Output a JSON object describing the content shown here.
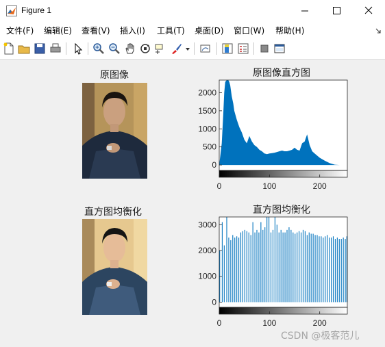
{
  "window": {
    "title": "Figure 1",
    "controls": [
      "minimize",
      "maximize",
      "close"
    ]
  },
  "menu": [
    {
      "label": "文件(F)"
    },
    {
      "label": "编辑(E)"
    },
    {
      "label": "查看(V)"
    },
    {
      "label": "插入(I)"
    },
    {
      "label": "工具(T)"
    },
    {
      "label": "桌面(D)"
    },
    {
      "label": "窗口(W)"
    },
    {
      "label": "帮助(H)"
    }
  ],
  "toolbar": {
    "icons": [
      "new-figure-icon",
      "open-file-icon",
      "save-icon",
      "print-icon",
      "pointer-icon",
      "zoom-in-icon",
      "zoom-out-icon",
      "pan-icon",
      "rotate-3d-icon",
      "data-cursor-icon",
      "brush-icon",
      "link-plot-icon",
      "colorbar-icon",
      "legend-icon",
      "hide-plot-tools-icon",
      "show-plot-tools-icon"
    ]
  },
  "subplots": [
    {
      "title": "原图像"
    },
    {
      "title": "原图像直方图"
    },
    {
      "title": "直方图均衡化"
    },
    {
      "title": "直方图均衡化"
    }
  ],
  "chart_data": [
    {
      "type": "area",
      "title": "原图像直方图",
      "xlim": [
        0,
        255
      ],
      "ylim": [
        -150,
        2350
      ],
      "xticks": [
        0,
        100,
        200
      ],
      "yticks": [
        0,
        500,
        1000,
        1500,
        2000
      ],
      "color": "#0072bd",
      "x": [
        0,
        5,
        8,
        10,
        12,
        15,
        18,
        20,
        22,
        25,
        28,
        30,
        35,
        40,
        45,
        50,
        55,
        60,
        65,
        70,
        75,
        80,
        85,
        90,
        95,
        100,
        105,
        110,
        115,
        120,
        125,
        130,
        135,
        140,
        145,
        150,
        155,
        160,
        165,
        170,
        175,
        180,
        185,
        190,
        200,
        210,
        220,
        230,
        240,
        255
      ],
      "y": [
        0,
        600,
        1400,
        2000,
        2300,
        2350,
        2350,
        2300,
        2200,
        1900,
        1700,
        1500,
        1250,
        1050,
        900,
        700,
        600,
        800,
        650,
        550,
        500,
        420,
        380,
        320,
        300,
        320,
        330,
        340,
        360,
        380,
        400,
        380,
        380,
        400,
        420,
        480,
        420,
        400,
        600,
        650,
        850,
        550,
        380,
        320,
        200,
        120,
        50,
        10,
        0,
        0
      ]
    },
    {
      "type": "bar",
      "title": "直方图均衡化",
      "xlim": [
        0,
        255
      ],
      "ylim": [
        -200,
        3300
      ],
      "xticks": [
        0,
        100,
        200
      ],
      "yticks": [
        0,
        1000,
        2000,
        3000
      ],
      "color": "#0072bd",
      "x": [
        1,
        6,
        10,
        15,
        19,
        23,
        27,
        31,
        35,
        39,
        43,
        47,
        51,
        55,
        59,
        63,
        67,
        71,
        75,
        79,
        83,
        87,
        91,
        95,
        99,
        103,
        107,
        111,
        115,
        119,
        123,
        127,
        131,
        135,
        139,
        143,
        147,
        151,
        155,
        159,
        163,
        167,
        171,
        175,
        179,
        183,
        187,
        191,
        195,
        199,
        203,
        207,
        211,
        215,
        219,
        223,
        227,
        231,
        235,
        239,
        243,
        247,
        251,
        254
      ],
      "y": [
        2000,
        3100,
        2200,
        3300,
        2500,
        2400,
        2600,
        2500,
        2550,
        2500,
        2700,
        2750,
        2800,
        2750,
        2700,
        2600,
        3100,
        2700,
        2800,
        2700,
        3100,
        2800,
        2900,
        3300,
        3300,
        2700,
        2800,
        3300,
        3000,
        2700,
        2800,
        2700,
        2700,
        2800,
        2900,
        2800,
        2700,
        2650,
        2700,
        2750,
        2700,
        2800,
        2750,
        2600,
        2700,
        2650,
        2650,
        2600,
        2600,
        2550,
        2550,
        2500,
        2550,
        2600,
        2500,
        2500,
        2550,
        2450,
        2500,
        2450,
        2450,
        2500,
        2450,
        2550
      ]
    }
  ],
  "watermark": "CSDN @极客范儿"
}
